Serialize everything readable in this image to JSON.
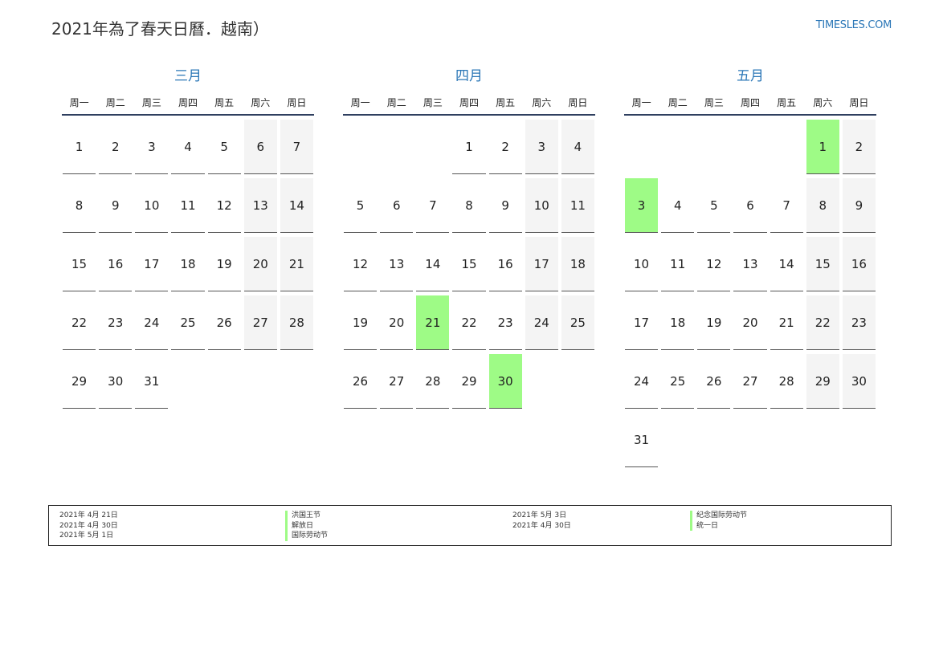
{
  "title": "2021年為了春天日曆．越南）",
  "site": "TIMESLES.COM",
  "weekdays": [
    "周一",
    "周二",
    "周三",
    "周四",
    "周五",
    "周六",
    "周日"
  ],
  "months": [
    {
      "name": "三月",
      "weeks": [
        [
          "1",
          "2",
          "3",
          "4",
          "5",
          "6",
          "7"
        ],
        [
          "8",
          "9",
          "10",
          "11",
          "12",
          "13",
          "14"
        ],
        [
          "15",
          "16",
          "17",
          "18",
          "19",
          "20",
          "21"
        ],
        [
          "22",
          "23",
          "24",
          "25",
          "26",
          "27",
          "28"
        ],
        [
          "29",
          "30",
          "31",
          "",
          "",
          "",
          ""
        ]
      ],
      "holidays": []
    },
    {
      "name": "四月",
      "weeks": [
        [
          "",
          "",
          "",
          "1",
          "2",
          "3",
          "4"
        ],
        [
          "5",
          "6",
          "7",
          "8",
          "9",
          "10",
          "11"
        ],
        [
          "12",
          "13",
          "14",
          "15",
          "16",
          "17",
          "18"
        ],
        [
          "19",
          "20",
          "21",
          "22",
          "23",
          "24",
          "25"
        ],
        [
          "26",
          "27",
          "28",
          "29",
          "30",
          "",
          ""
        ]
      ],
      "holidays": [
        "21",
        "30"
      ]
    },
    {
      "name": "五月",
      "weeks": [
        [
          "",
          "",
          "",
          "",
          "",
          "1",
          "2"
        ],
        [
          "3",
          "4",
          "5",
          "6",
          "7",
          "8",
          "9"
        ],
        [
          "10",
          "11",
          "12",
          "13",
          "14",
          "15",
          "16"
        ],
        [
          "17",
          "18",
          "19",
          "20",
          "21",
          "22",
          "23"
        ],
        [
          "24",
          "25",
          "26",
          "27",
          "28",
          "29",
          "30"
        ],
        [
          "31",
          "",
          "",
          "",
          "",
          "",
          ""
        ]
      ],
      "holidays": [
        "1",
        "3"
      ]
    }
  ],
  "legend": {
    "left": [
      {
        "date": "2021年 4月 21日",
        "name": "洪国王节"
      },
      {
        "date": "2021年 4月 30日",
        "name": "解放日"
      },
      {
        "date": "2021年 5月 1日",
        "name": "国际劳动节"
      }
    ],
    "right": [
      {
        "date": "2021年 5月 3日",
        "name": "纪念国际劳动节"
      },
      {
        "date": "2021年 4月 30日",
        "name": "统一日"
      }
    ]
  },
  "colors": {
    "accent": "#2b77b7",
    "holiday": "#9efb86",
    "weekend": "#f4f4f4",
    "header_line": "#2f3f5f"
  }
}
